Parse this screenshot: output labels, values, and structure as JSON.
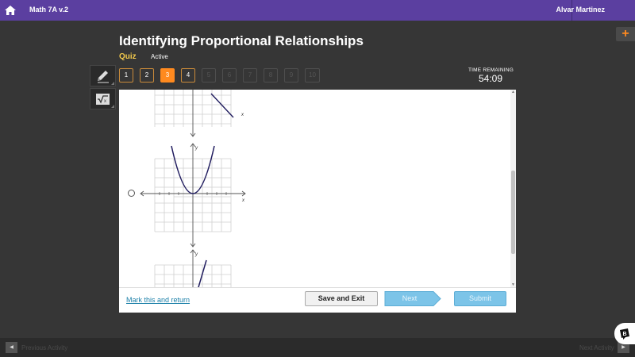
{
  "header": {
    "course": "Math 7A v.2",
    "user": "Alvar Martinez"
  },
  "page": {
    "title": "Identifying Proportional Relationships",
    "type_label": "Quiz",
    "status": "Active"
  },
  "questions": [
    "1",
    "2",
    "3",
    "4",
    "5",
    "6",
    "7",
    "8",
    "9",
    "10"
  ],
  "current_question": "3",
  "timer": {
    "label": "TIME REMAINING",
    "value": "54:09"
  },
  "tools": {
    "pencil": "pencil-icon",
    "calculator": "calculator-icon"
  },
  "graphs": {
    "x_label": "x",
    "y_label": "y"
  },
  "footer": {
    "mark_link": "Mark this and return",
    "save_label": "Save and Exit",
    "next_label": "Next",
    "submit_label": "Submit"
  },
  "nav": {
    "prev_label": "Previous Activity",
    "next_label": "Next Activity"
  },
  "colors": {
    "header": "#5b3fa0",
    "accent": "#ff8a1f",
    "curve": "#1f1b5e",
    "button_blue": "#7cc4e8"
  }
}
